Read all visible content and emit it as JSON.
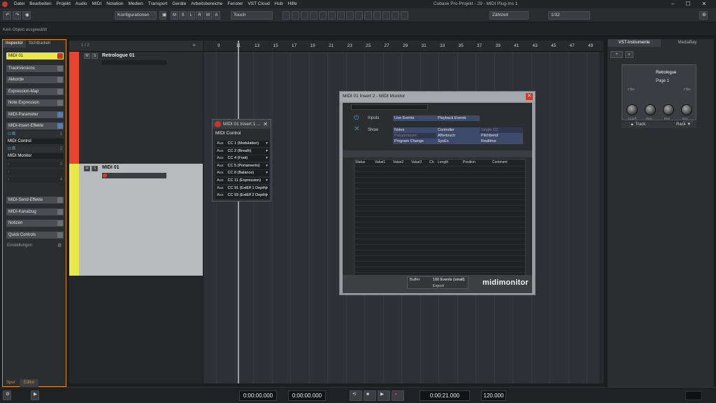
{
  "menubar": {
    "items": [
      "Datei",
      "Bearbeiten",
      "Projekt",
      "Audio",
      "MIDI",
      "Notation",
      "Medien",
      "Transport",
      "Geräte",
      "Arbeitsbereiche",
      "Fenster",
      "VST Cloud",
      "Hub",
      "Hilfe"
    ],
    "window_title": "Cubase Pro-Projekt - 29 - MIDI Plug-Ins 1"
  },
  "toolbar": {
    "configurations": "Konfigurationen",
    "mode_buttons": [
      "M",
      "S",
      "L",
      "R",
      "W",
      "A"
    ],
    "touch_mode": "Touch",
    "grid_type": "Zählzeit",
    "quantize": "1/32"
  },
  "statusline": {
    "text": "Kein Objekt ausgewählt"
  },
  "inspector": {
    "tabs": [
      "Inspector",
      "Sichtbarkeit"
    ],
    "track_name": "MIDI 01",
    "sections": [
      "TrackVersions",
      "Akkorde",
      "Expression-Map",
      "Note Expression",
      "MIDI-Parameter",
      "MIDI-Insert-Effekte"
    ],
    "insert_slots": [
      "MIDI Control",
      "MIDI Monitor"
    ],
    "slot_numbers": [
      "1",
      "2",
      "3",
      "4"
    ],
    "lower_sections": [
      "MIDI-Send-Effekte",
      "MIDI-Kanalzug",
      "Notizen",
      "Quick Controls"
    ],
    "settings_label": "Einstellungen",
    "bottom_tabs": [
      "Spur",
      "Editor"
    ]
  },
  "tracklist": {
    "counter": "1 / 2",
    "tracks": [
      {
        "name": "Retrologue 01",
        "color": "#e8452f"
      },
      {
        "name": "MIDI 01",
        "color": "#e8e84a"
      }
    ]
  },
  "ruler": {
    "bars": [
      "9",
      "11",
      "13",
      "15",
      "17",
      "19",
      "21",
      "23",
      "25",
      "27",
      "29",
      "31",
      "33",
      "35",
      "37",
      "39",
      "41",
      "43",
      "45",
      "47",
      "49"
    ]
  },
  "midi_control": {
    "title": "MIDI 01 Insert 1 ...",
    "header": "MIDI Control",
    "rows": [
      {
        "state": "Aus",
        "label": "CC 1 (Modulation)"
      },
      {
        "state": "Aus",
        "label": "CC 2 (Breath)"
      },
      {
        "state": "Aus",
        "label": "CC 4 (Foot)"
      },
      {
        "state": "Aus",
        "label": "CC 5 (Portamento)"
      },
      {
        "state": "Aus",
        "label": "CC 8 (Balance)"
      },
      {
        "state": "Aus",
        "label": "CC 11 (Expression)"
      },
      {
        "state": "Aus",
        "label": "CC 91 (ExtEff 1 Depth)"
      },
      {
        "state": "Aus",
        "label": "CC 93 (ExtEff 2 Depth)"
      }
    ]
  },
  "midi_monitor": {
    "title": "MIDI 01 Insert 2 - MIDI Monitor",
    "inputs_label": "Inputs",
    "inputs": [
      "Live Events",
      "Playback Events"
    ],
    "show_label": "Show",
    "show_options": [
      [
        "Notes",
        "Controller",
        "Single CC"
      ],
      [
        "Polypressure",
        "Aftertouch",
        "Pitchbend"
      ],
      [
        "Program Change",
        "SysEx",
        "Realtime"
      ]
    ],
    "columns": [
      "Status",
      "Value1",
      "Value2",
      "Value3",
      "Ch.",
      "Length",
      "Position",
      "Comment"
    ],
    "buffer_label": "Buffer",
    "buffer_value": "100 Events (small)",
    "export_label": "Export",
    "logo": "midimonitor"
  },
  "rightzone": {
    "tabs": [
      "VST-Instrumente",
      "MediaBay"
    ],
    "instrument_name": "Retrologue",
    "page": "Page 1",
    "knob_groups": [
      "Filter",
      "Filter"
    ],
    "knob_labels": [
      "Cutoff",
      "Res",
      "Res",
      "Env Amount"
    ],
    "footer": [
      "Track",
      "Rack"
    ]
  },
  "transport": {
    "left_locator": "0:00:00.000",
    "right_locator": "0:00:00.000",
    "position": "0:00:21.000",
    "tempo": "120.000"
  }
}
